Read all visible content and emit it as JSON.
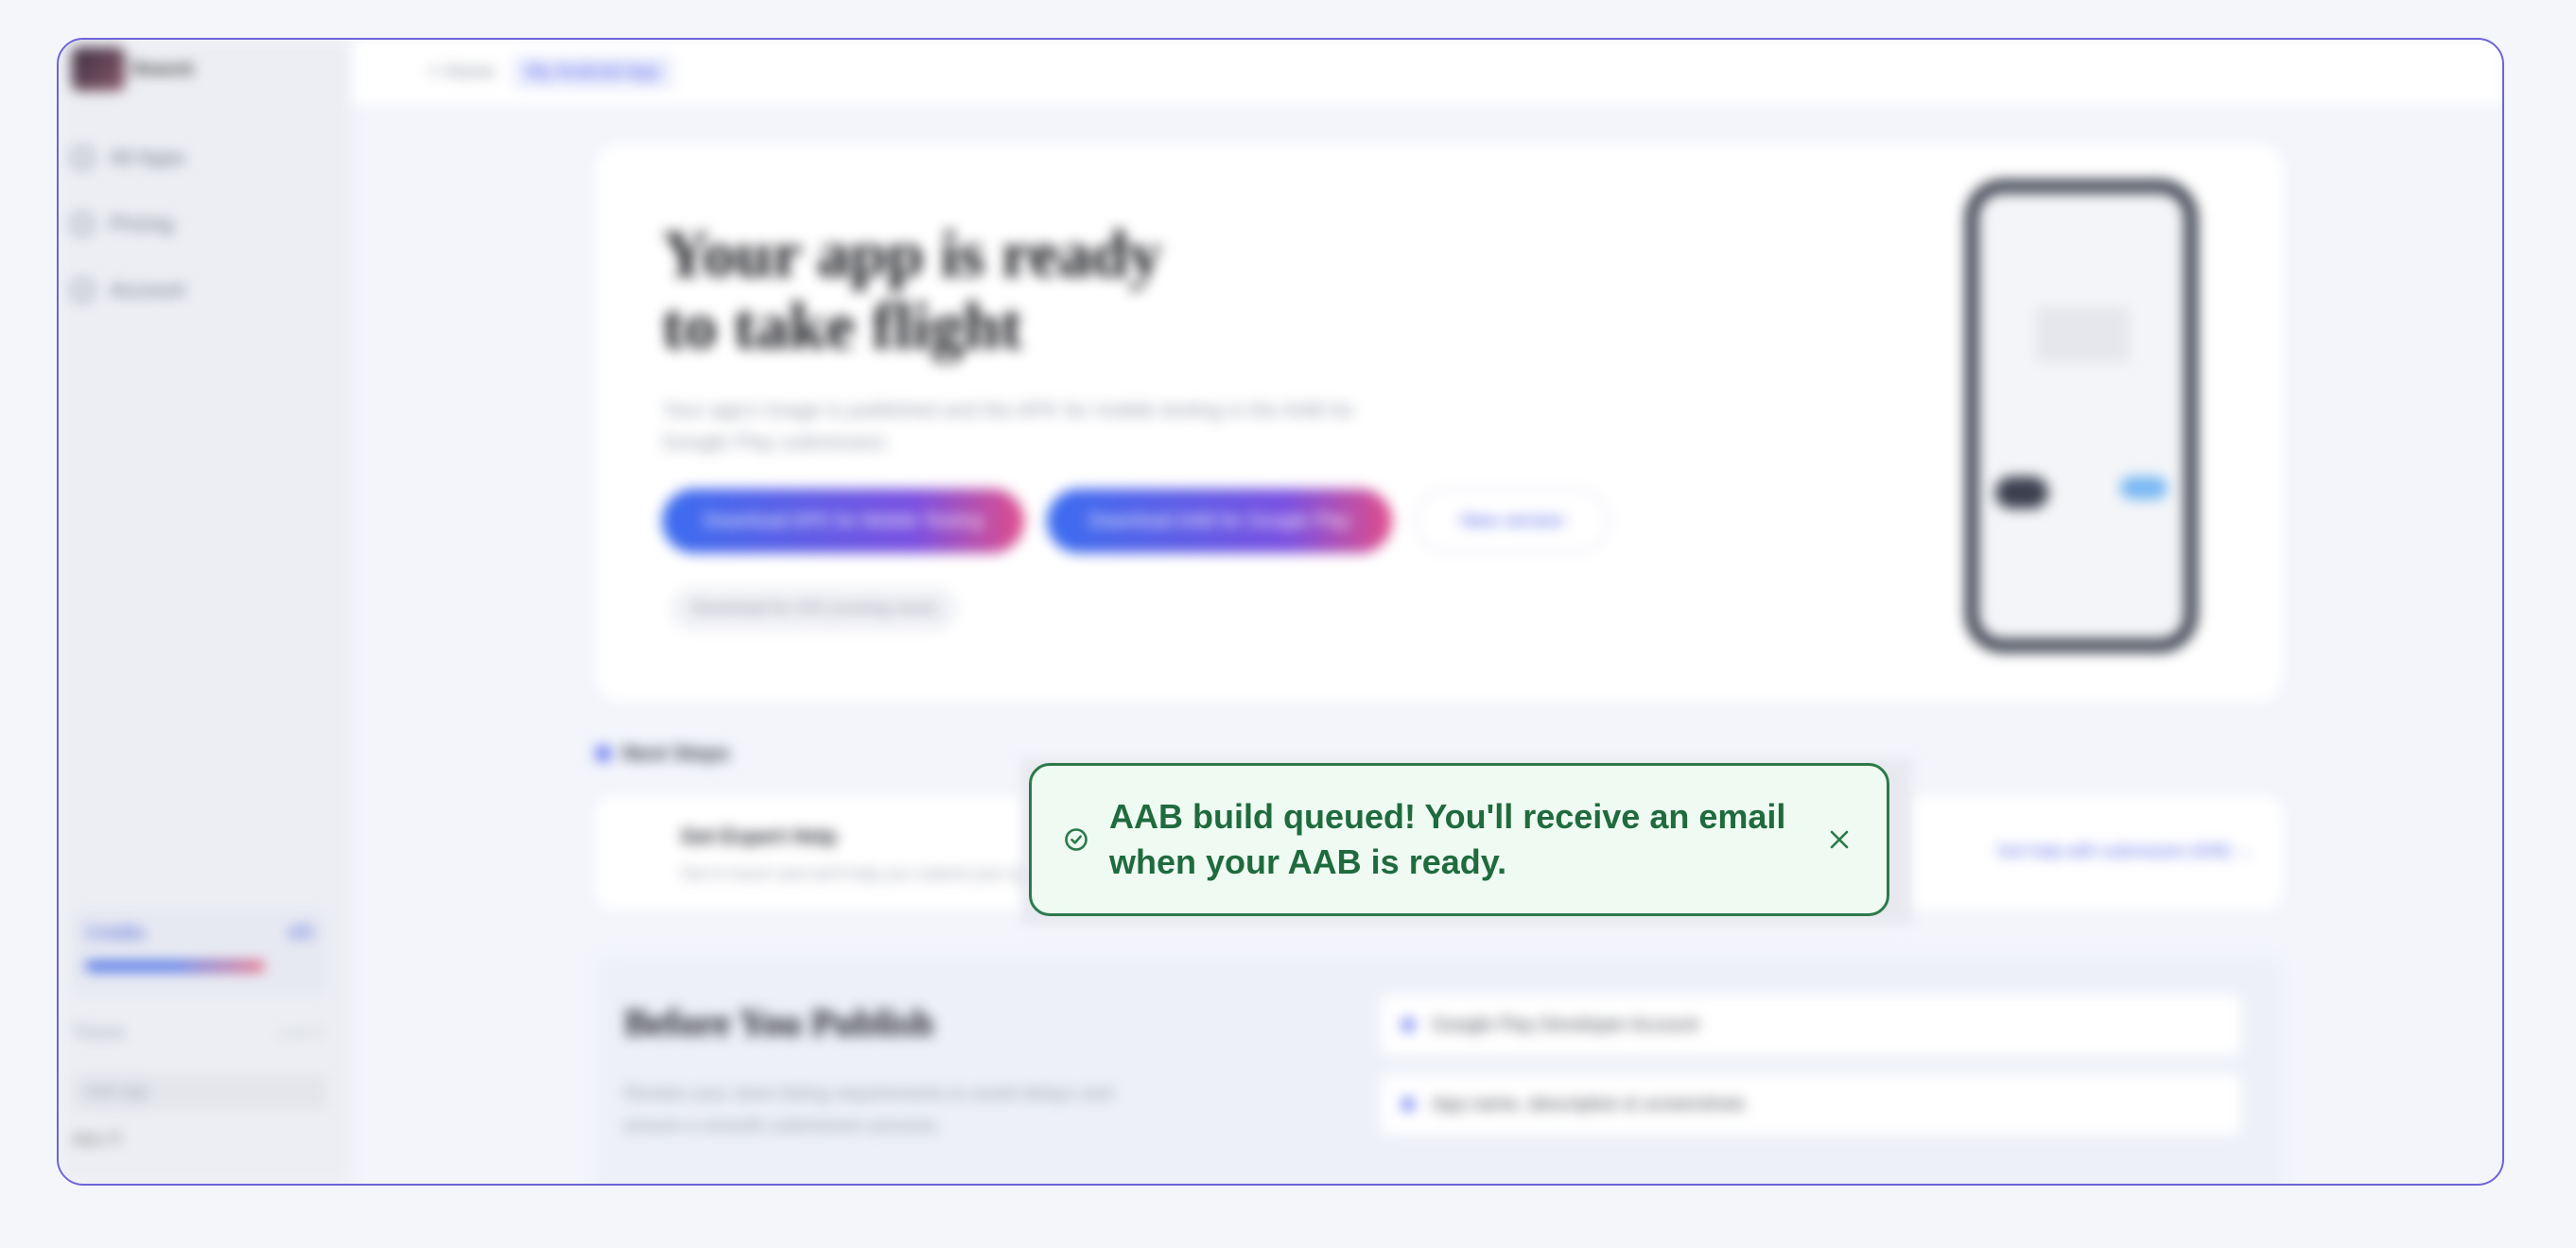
{
  "sidebar": {
    "brand_text": "Rework",
    "items": [
      {
        "label": "All Apps"
      },
      {
        "label": "Pricing"
      },
      {
        "label": "Account"
      }
    ],
    "usage": {
      "label": "Credits",
      "count": "4/5"
    },
    "theme_label": "Theme",
    "add_input_placeholder": "Add app",
    "user": "Alex P."
  },
  "topbar": {
    "back_label": "< Home",
    "current_label": "My Android App"
  },
  "hero": {
    "title_line1": "Your app is ready",
    "title_line2": "to take flight",
    "description": "Your app's image is published and the APK for mobile testing is the AAB for Google Play submission.",
    "btn_apk": "Download APK for Mobile Testing",
    "btn_aab": "Download AAB for Google Play",
    "btn_new": "New version",
    "tag": "Download for iOS (coming soon)"
  },
  "next_steps": {
    "label": "Next Steps",
    "card_title": "Get Expert Help",
    "card_sub": "Get in touch and we'll help you submit your app to Google Play",
    "card_link": "Get help with submission (€49) →"
  },
  "publish": {
    "title": "Before You Publish",
    "description": "Review your store listing requirements to avoid delays and ensure a smooth submission process.",
    "items": [
      {
        "label": "Google Play Developer Account"
      },
      {
        "label": "App name, description & screenshots"
      }
    ]
  },
  "toast": {
    "message": "AAB build queued! You'll receive an email when your AAB is ready.",
    "status_color": "#2b7a4a"
  }
}
